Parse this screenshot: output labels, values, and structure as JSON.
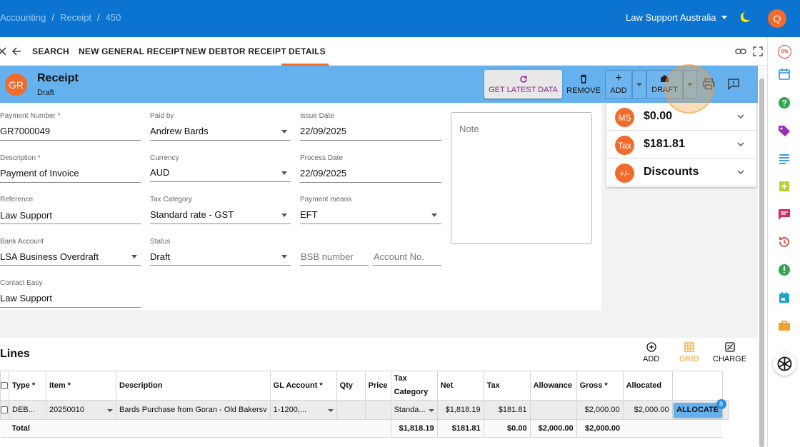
{
  "breadcrumb": [
    "Accounting",
    "Receipt",
    "450"
  ],
  "org": {
    "name": "Law Support Australia"
  },
  "user": {
    "initial": "Q"
  },
  "nav": {
    "tabs": [
      "SEARCH",
      "NEW GENERAL RECEIPT",
      "NEW DEBTOR RECEIPT",
      "DETAILS"
    ],
    "active": "DETAILS"
  },
  "header": {
    "avatar": "GR",
    "title": "Receipt",
    "status": "Draft",
    "get_latest": "GET LATEST DATA",
    "remove": "REMOVE",
    "add": "ADD",
    "draft": "DRAFT"
  },
  "form": {
    "payment_number": {
      "label": "Payment Number *",
      "value": "GR7000049"
    },
    "paid_by": {
      "label": "Paid by",
      "value": "Andrew Bards"
    },
    "issue_date": {
      "label": "Issue Date",
      "value": "22/09/2025"
    },
    "description": {
      "label": "Description *",
      "value": "Payment of Invoice"
    },
    "currency": {
      "label": "Currency",
      "value": "AUD"
    },
    "process_date": {
      "label": "Process Date",
      "value": "22/09/2025"
    },
    "reference": {
      "label": "Reference",
      "value": "Law Support"
    },
    "tax_category": {
      "label": "Tax Category",
      "value": "Standard rate - GST"
    },
    "payment_means": {
      "label": "Payment means",
      "value": "EFT"
    },
    "bank_account": {
      "label": "Bank Account",
      "value": "LSA Business Overdraft"
    },
    "status": {
      "label": "Status",
      "value": "Draft"
    },
    "bsb_placeholder": "BSB number",
    "account_placeholder": "Account No.",
    "contact": {
      "label": "Contact Easy",
      "value": "Law Support"
    },
    "note_placeholder": "Note"
  },
  "summary": [
    {
      "avatar": "MS",
      "text": "$0.00"
    },
    {
      "avatar": "Tax",
      "text": "$181.81"
    },
    {
      "avatar": "+/-",
      "text": "Discounts"
    }
  ],
  "lines": {
    "title": "Lines",
    "buttons": {
      "add": "ADD",
      "grid": "GRID",
      "charge": "CHARGE"
    },
    "columns": [
      "Type *",
      "Item *",
      "Description",
      "GL Account *",
      "Qty",
      "Price",
      "Tax Category",
      "Net",
      "Tax",
      "Allowance",
      "Gross *",
      "Allocated"
    ],
    "row": {
      "type": "DEB...",
      "item": "20250010",
      "description": "Bards Purchase from Goran - Old Bakersv",
      "gl_account": "1-1200,...",
      "qty": "",
      "price": "",
      "tax_category": "Standa...",
      "net": "$1,818.19",
      "tax": "$181.81",
      "allowance": "",
      "gross": "$2,000.00",
      "allocated": "$2,000.00",
      "allocate_label": "ALLOCATE",
      "allocate_badge": "8"
    },
    "total": {
      "label": "Total",
      "net": "$1,818.19",
      "tax": "$181.81",
      "allowance": "$0.00",
      "gross": "$2,000.00",
      "allocated": "$2,000.00"
    }
  },
  "colors": {
    "topbar": "#0a74d0",
    "header_band": "#64b1ee",
    "accent": "#f26b2b",
    "get_latest_text": "#8b2a8e",
    "grid_active": "#f0a030"
  }
}
